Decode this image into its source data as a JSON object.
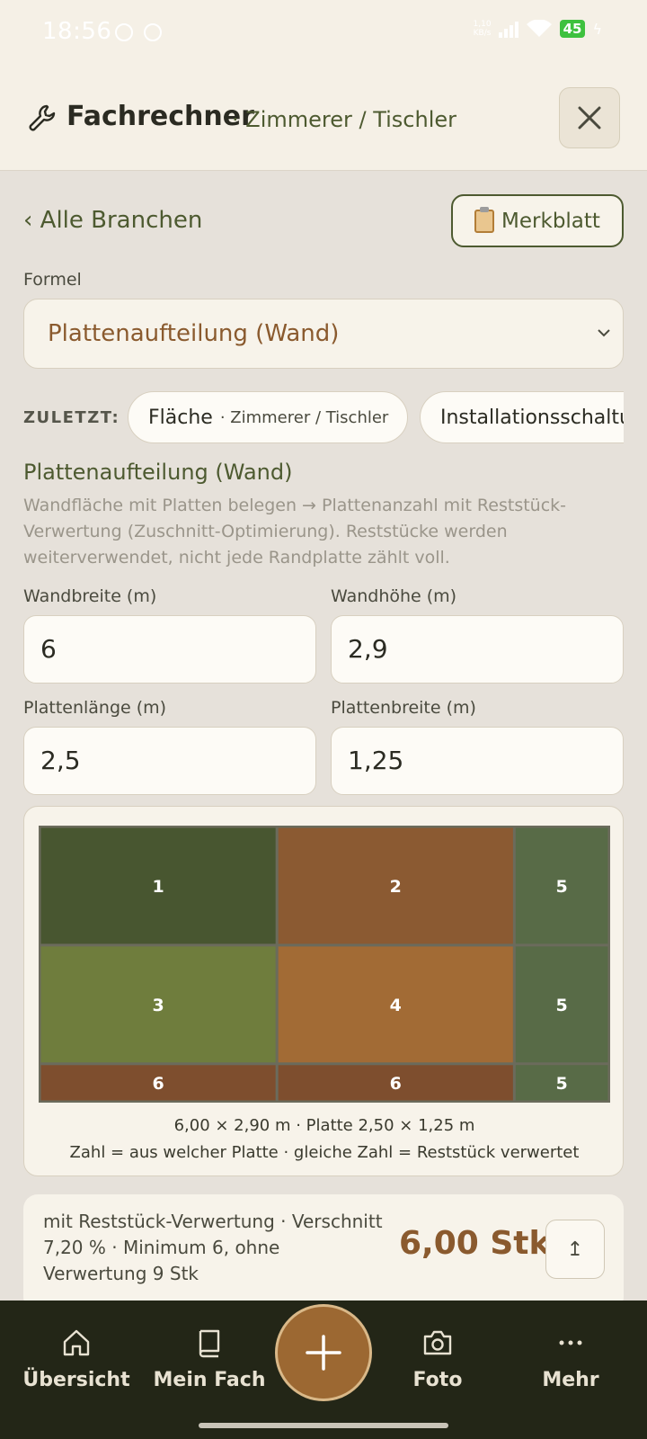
{
  "status_bar": {
    "time": "18:56",
    "net_speed_top": "1,10",
    "net_speed_bottom": "KB/s",
    "battery": "45"
  },
  "header": {
    "title": "Fachrechner",
    "subtitle": "· Zimmerer / Tischler"
  },
  "nav": {
    "back_label": "‹ Alle Branchen",
    "merkblatt_label": "Merkblatt"
  },
  "formula": {
    "label": "Formel",
    "selected": "Plattenaufteilung (Wand)"
  },
  "recent": {
    "label": "ZULETZT:",
    "chips": [
      {
        "main": "Fläche",
        "sub": "· Zimmerer / Tischler"
      },
      {
        "main": "Installationsschaltu",
        "sub": ""
      }
    ]
  },
  "formula_info": {
    "title": "Plattenaufteilung (Wand)",
    "description": "Wandfläche mit Platten belegen → Plattenanzahl mit Reststück-Verwertung (Zuschnitt-Optimierung). Reststücke werden weiterverwendet, nicht jede Randplatte zählt voll."
  },
  "inputs": [
    {
      "label": "Wandbreite (m)",
      "value": "6"
    },
    {
      "label": "Wandhöhe (m)",
      "value": "2,9"
    },
    {
      "label": "Plattenlänge (m)",
      "value": "2,5"
    },
    {
      "label": "Plattenbreite (m)",
      "value": "1,25"
    }
  ],
  "layout_diagram": {
    "wall_width": 6.0,
    "wall_height": 2.9,
    "panel_length": 2.5,
    "panel_width": 1.25,
    "cells": [
      {
        "label": "1",
        "x0": 0,
        "x1": 2.5,
        "y0": 0,
        "y1": 1.25,
        "color": "#485630"
      },
      {
        "label": "2",
        "x0": 2.5,
        "x1": 5.0,
        "y0": 0,
        "y1": 1.25,
        "color": "#8b5a32"
      },
      {
        "label": "5",
        "x0": 5.0,
        "x1": 6.0,
        "y0": 0,
        "y1": 1.25,
        "color": "#586b47"
      },
      {
        "label": "3",
        "x0": 0,
        "x1": 2.5,
        "y0": 1.25,
        "y1": 2.5,
        "color": "#6f7d3d"
      },
      {
        "label": "4",
        "x0": 2.5,
        "x1": 5.0,
        "y0": 1.25,
        "y1": 2.5,
        "color": "#a26b35"
      },
      {
        "label": "5",
        "x0": 5.0,
        "x1": 6.0,
        "y0": 1.25,
        "y1": 2.5,
        "color": "#586b47"
      },
      {
        "label": "6",
        "x0": 0,
        "x1": 2.5,
        "y0": 2.5,
        "y1": 2.9,
        "color": "#7e4e2e"
      },
      {
        "label": "6",
        "x0": 2.5,
        "x1": 5.0,
        "y0": 2.5,
        "y1": 2.9,
        "color": "#7e4e2e"
      },
      {
        "label": "5",
        "x0": 5.0,
        "x1": 6.0,
        "y0": 2.5,
        "y1": 2.9,
        "color": "#586b47"
      }
    ],
    "caption_line1": "6,00 × 2,90 m · Platte 2,50 × 1,25 m",
    "caption_line2": "Zahl = aus welcher Platte · gleiche Zahl = Reststück verwertet"
  },
  "result": {
    "text": "mit Reststück-Verwertung · Verschnitt 7,20 % · Minimum 6, ohne Verwertung 9 Stk",
    "value": "6,00 Stk",
    "share_icon": "↥"
  },
  "bottom_nav": {
    "items": [
      {
        "label": "Übersicht",
        "icon": "home-icon"
      },
      {
        "label": "Mein Fach",
        "icon": "book-icon"
      },
      {
        "label": "Foto",
        "icon": "camera-icon"
      },
      {
        "label": "Mehr",
        "icon": "more-icon"
      }
    ],
    "fab_icon": "plus-icon"
  },
  "colors": {
    "accent_green": "#4d5a30",
    "accent_brown": "#8a5a2e",
    "nav_bg": "#232617",
    "page_bg": "#e6e1da"
  }
}
